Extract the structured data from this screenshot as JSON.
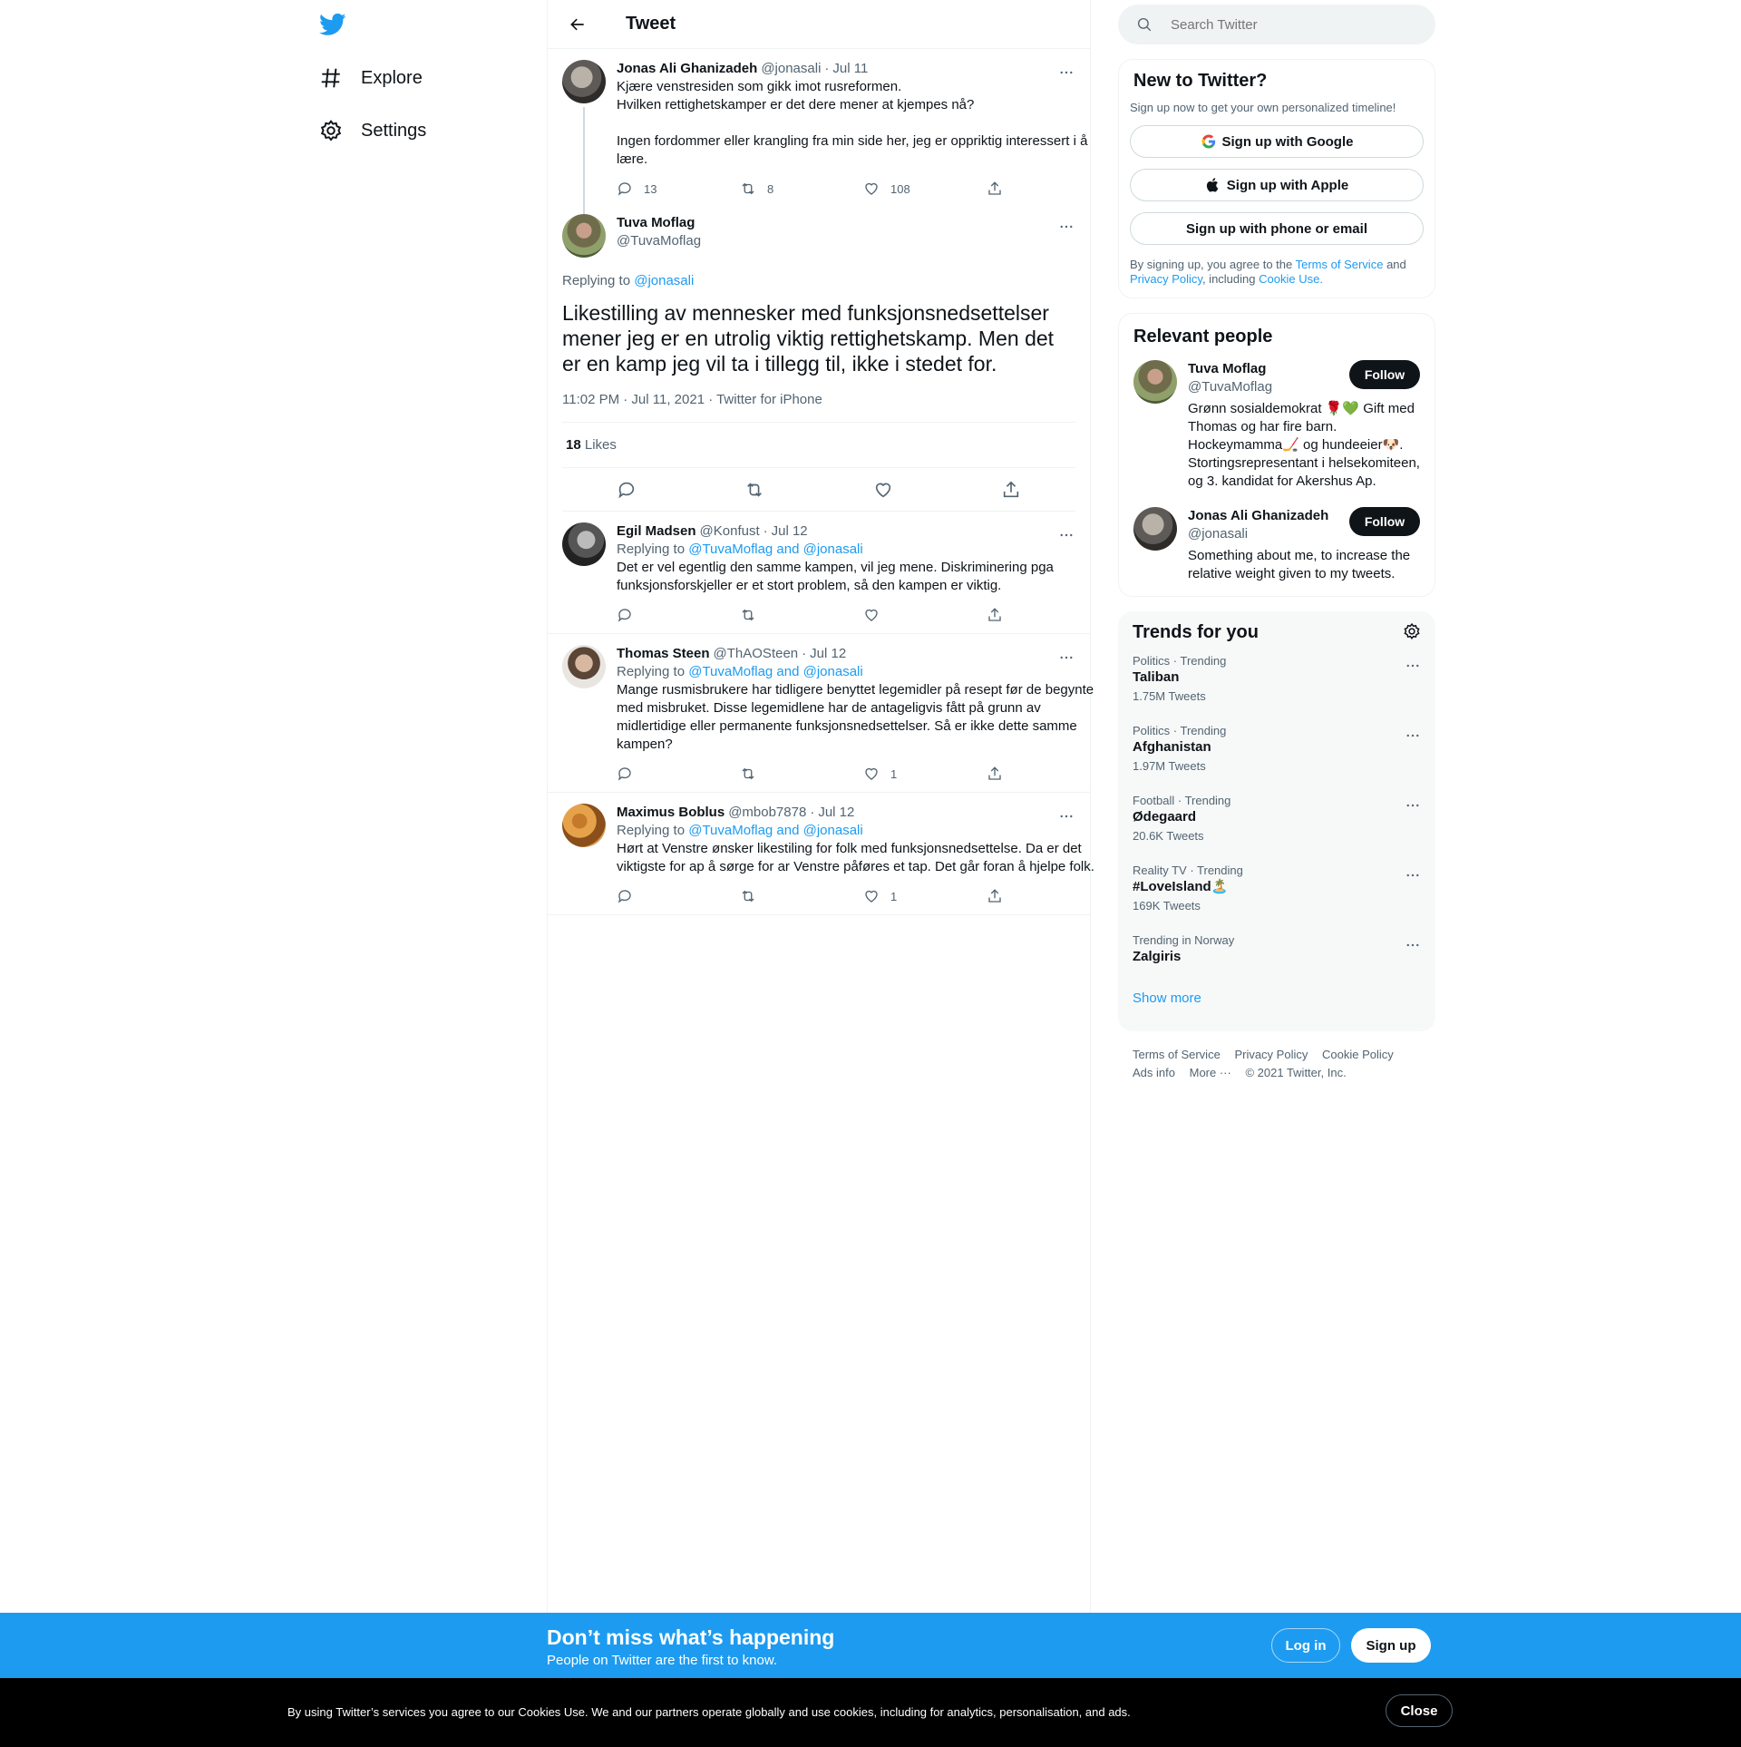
{
  "nav": {
    "explore": "Explore",
    "settings": "Settings"
  },
  "header": {
    "title": "Tweet"
  },
  "parent_tweet": {
    "name": "Jonas Ali Ghanizadeh",
    "handle": "@jonasali",
    "date": "Jul 11",
    "text": "Kjære venstresiden som gikk imot rusreformen.\nHvilken rettighetskamper er det dere mener at kjempes nå?\n\nIngen fordommer eller krangling fra min side her, jeg er oppriktig interessert i å lære.",
    "replies": "13",
    "retweets": "8",
    "likes": "108"
  },
  "main_tweet": {
    "name": "Tuva Moflag",
    "handle": "@TuvaMoflag",
    "replying_prefix": "Replying to",
    "replying_to": "@jonasali",
    "text": "Likestilling av mennesker med funksjonsnedsettelser mener jeg er en utrolig viktig rettighetskamp. Men det er en kamp jeg vil ta i tillegg til, ikke i stedet for.",
    "timestamp": "11:02 PM · Jul 11, 2021 · Twitter for iPhone",
    "likes_count": "18",
    "likes_label": "Likes"
  },
  "replies": [
    {
      "name": "Egil Madsen",
      "handle": "@Konfust",
      "date": "Jul 12",
      "replying_prefix": "Replying to",
      "replying_to": "@TuvaMoflag and @jonasali",
      "text": "Det er vel egentlig den samme kampen, vil jeg mene. Diskriminering pga funksjonsforskjeller er et stort problem, så den kampen er viktig.",
      "likes": ""
    },
    {
      "name": "Thomas Steen",
      "handle": "@ThAOSteen",
      "date": "Jul 12",
      "replying_prefix": "Replying to",
      "replying_to": "@TuvaMoflag and @jonasali",
      "text": "Mange rusmisbrukere har tidligere benyttet legemidler på resept før de begynte med misbruket. Disse legemidlene har de antageligvis fått på grunn av midlertidige eller permanente funksjonsnedsettelser. Så er ikke dette samme kampen?",
      "likes": "1"
    },
    {
      "name": "Maximus Boblus",
      "handle": "@mbob7878",
      "date": "Jul 12",
      "replying_prefix": "Replying to",
      "replying_to": "@TuvaMoflag and @jonasali",
      "text": "Hørt at Venstre ønsker likestiling for folk med funksjonsnedsettelse. Da er det viktigste for ap å sørge for ar Venstre påføres et tap. Det går foran å hjelpe folk.",
      "likes": "1"
    }
  ],
  "search": {
    "placeholder": "Search Twitter"
  },
  "signup": {
    "title": "New to Twitter?",
    "subtitle": "Sign up now to get your own personalized timeline!",
    "google": "Sign up with Google",
    "apple": "Sign up with Apple",
    "phone": "Sign up with phone or email",
    "legal_1": "By signing up, you agree to the",
    "tos": "Terms of Service",
    "legal_2": "and",
    "privacy": "Privacy Policy",
    "legal_3": ", including",
    "cookie": "Cookie Use."
  },
  "relevant": {
    "title": "Relevant people",
    "follow_label": "Follow",
    "people": [
      {
        "name": "Tuva Moflag",
        "handle": "@TuvaMoflag",
        "bio": "Grønn sosialdemokrat 🌹💚 Gift med Thomas og har fire barn. Hockeymamma🏒 og hundeeier🐶. Stortingsrepresentant i helsekomiteen, og 3. kandidat for Akershus Ap."
      },
      {
        "name": "Jonas Ali Ghanizadeh",
        "handle": "@jonasali",
        "bio": "Something about me, to increase the relative weight given to my tweets."
      }
    ]
  },
  "trends": {
    "title": "Trends for you",
    "items": [
      {
        "meta": "Politics · Trending",
        "name": "Taliban",
        "count": "1.75M Tweets"
      },
      {
        "meta": "Politics · Trending",
        "name": "Afghanistan",
        "count": "1.97M Tweets"
      },
      {
        "meta": "Football · Trending",
        "name": "Ødegaard",
        "count": "20.6K Tweets"
      },
      {
        "meta": "Reality TV · Trending",
        "name": "#LoveIsland🏝️",
        "count": "169K Tweets"
      },
      {
        "meta": "Trending in Norway",
        "name": "Zalgiris",
        "count": ""
      }
    ],
    "show_more": "Show more"
  },
  "footer": {
    "tos": "Terms of Service",
    "privacy": "Privacy Policy",
    "cookie": "Cookie Policy",
    "ads": "Ads info",
    "more": "More ···",
    "copyright": "© 2021 Twitter, Inc."
  },
  "bottom_bar": {
    "title": "Don’t miss what’s happening",
    "subtitle": "People on Twitter are the first to know.",
    "login": "Log in",
    "signup": "Sign up"
  },
  "cookie_bar": {
    "text": "By using Twitter’s services you agree to our Cookies Use. We and our partners operate globally and use cookies, including for analytics, personalisation, and ads.",
    "close": "Close"
  },
  "colors": {
    "accent": "#1d9bf0",
    "text": "#0f1419",
    "muted": "#536471"
  }
}
